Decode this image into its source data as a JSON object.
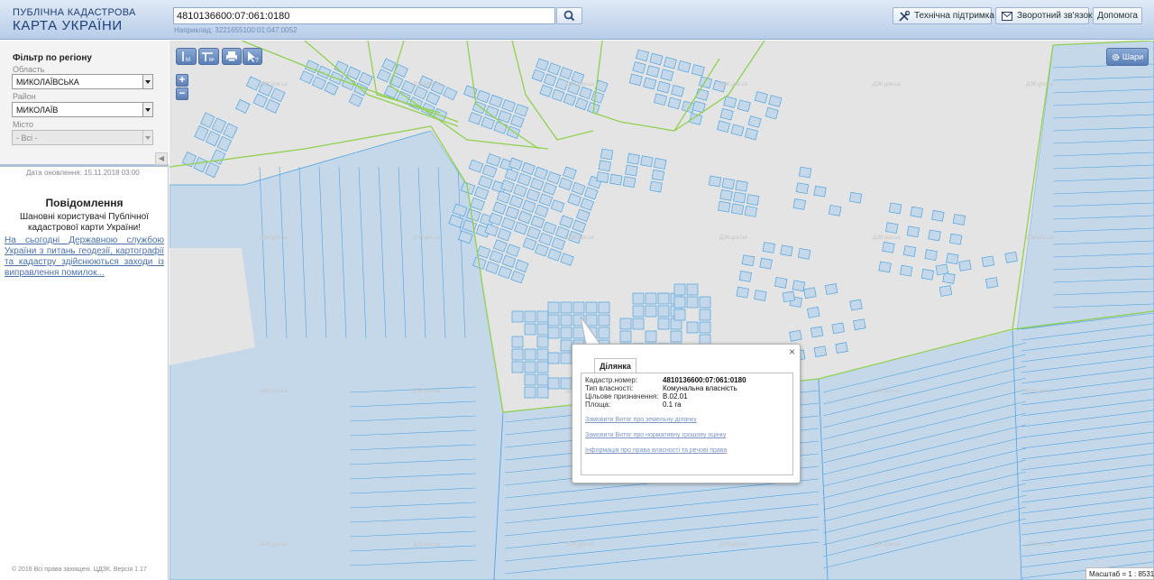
{
  "header": {
    "logo_line1": "ПУБЛІЧНА КАДАСТРОВА",
    "logo_line2": "КАРТА УКРАЇНИ",
    "search_value": "4810136600:07:061:0180",
    "search_hint": "Наприклад: 3221655100:01:047:0052",
    "btn_support": "Технічна підтримка",
    "btn_feedback": "Зворотний зв'язок",
    "btn_help": "Допомога"
  },
  "sidebar": {
    "filter_title": "Фільтр по регіону",
    "region_label": "Область",
    "region_value": "МИКОЛАЇВСЬКА",
    "district_label": "Район",
    "district_value": "МИКОЛАЇВ",
    "city_label": "Місто",
    "city_value": "- Всі -",
    "update_date": "Дата оновлення: 15.11.2018 03:00",
    "notice_title": "Повідомлення",
    "notice_greeting": "Шановні користувачі Публічної кадастрової карти України!",
    "notice_link": "На сьогодні Державною службою України з питань геодезії, картографії та кадастру здійснюються заходи із виправлення помилок...",
    "copyright": "© 2016 Всі права захищені. ЦДЗК. Версія 1.17"
  },
  "map": {
    "layers_label": "Шари",
    "scale_text": "Масштаб = 1 : 8531",
    "watermark": "ДЗК.gov.ua",
    "colors": {
      "parcel_fill": "#c5d8ea",
      "parcel_stroke": "#4fa3e0",
      "boundary": "#8fd14f",
      "map_bg": "#e4e4e4"
    }
  },
  "popup": {
    "tab": "Ділянка",
    "rows": [
      {
        "key": "Кадастр.номер:",
        "value": "4810136600:07:061:0180"
      },
      {
        "key": "Тип власності:",
        "value": "Комунальна власність"
      },
      {
        "key": "Цільове призначення:",
        "value": "В.02.01"
      },
      {
        "key": "Площа:",
        "value": "0.1 га"
      }
    ],
    "link1": "Замовити Витяг про земельну ділянку",
    "link2": "Замовити Витяг про нормативну грошову оцінку",
    "link3": "Інформація про права власності та речові права"
  }
}
